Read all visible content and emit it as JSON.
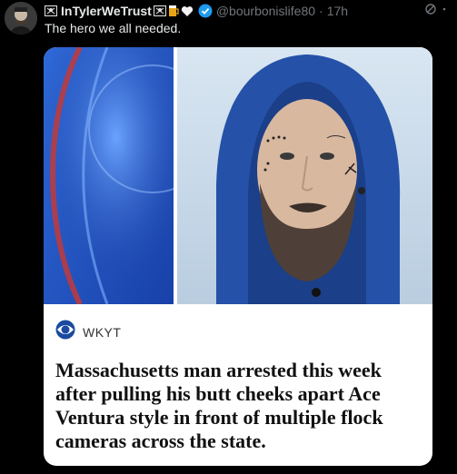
{
  "author": {
    "display_name": "InTylerWeTrust",
    "handle": "@bourbonislife80",
    "time": "17h",
    "name_emojis": [
      "pirate-flag",
      "pirate-flag",
      "beer-mug",
      "white-heart"
    ]
  },
  "tweet": {
    "text": "The hero we all needed."
  },
  "card": {
    "source": "WKYT",
    "headline": "Massachusetts man arrested this week after pulling his butt cheeks apart Ace Ventura style in front of multiple flock cameras across the state."
  },
  "colors": {
    "verified": "#1d9bf0",
    "text_primary": "#e7e9ea",
    "text_secondary": "#71767b"
  }
}
